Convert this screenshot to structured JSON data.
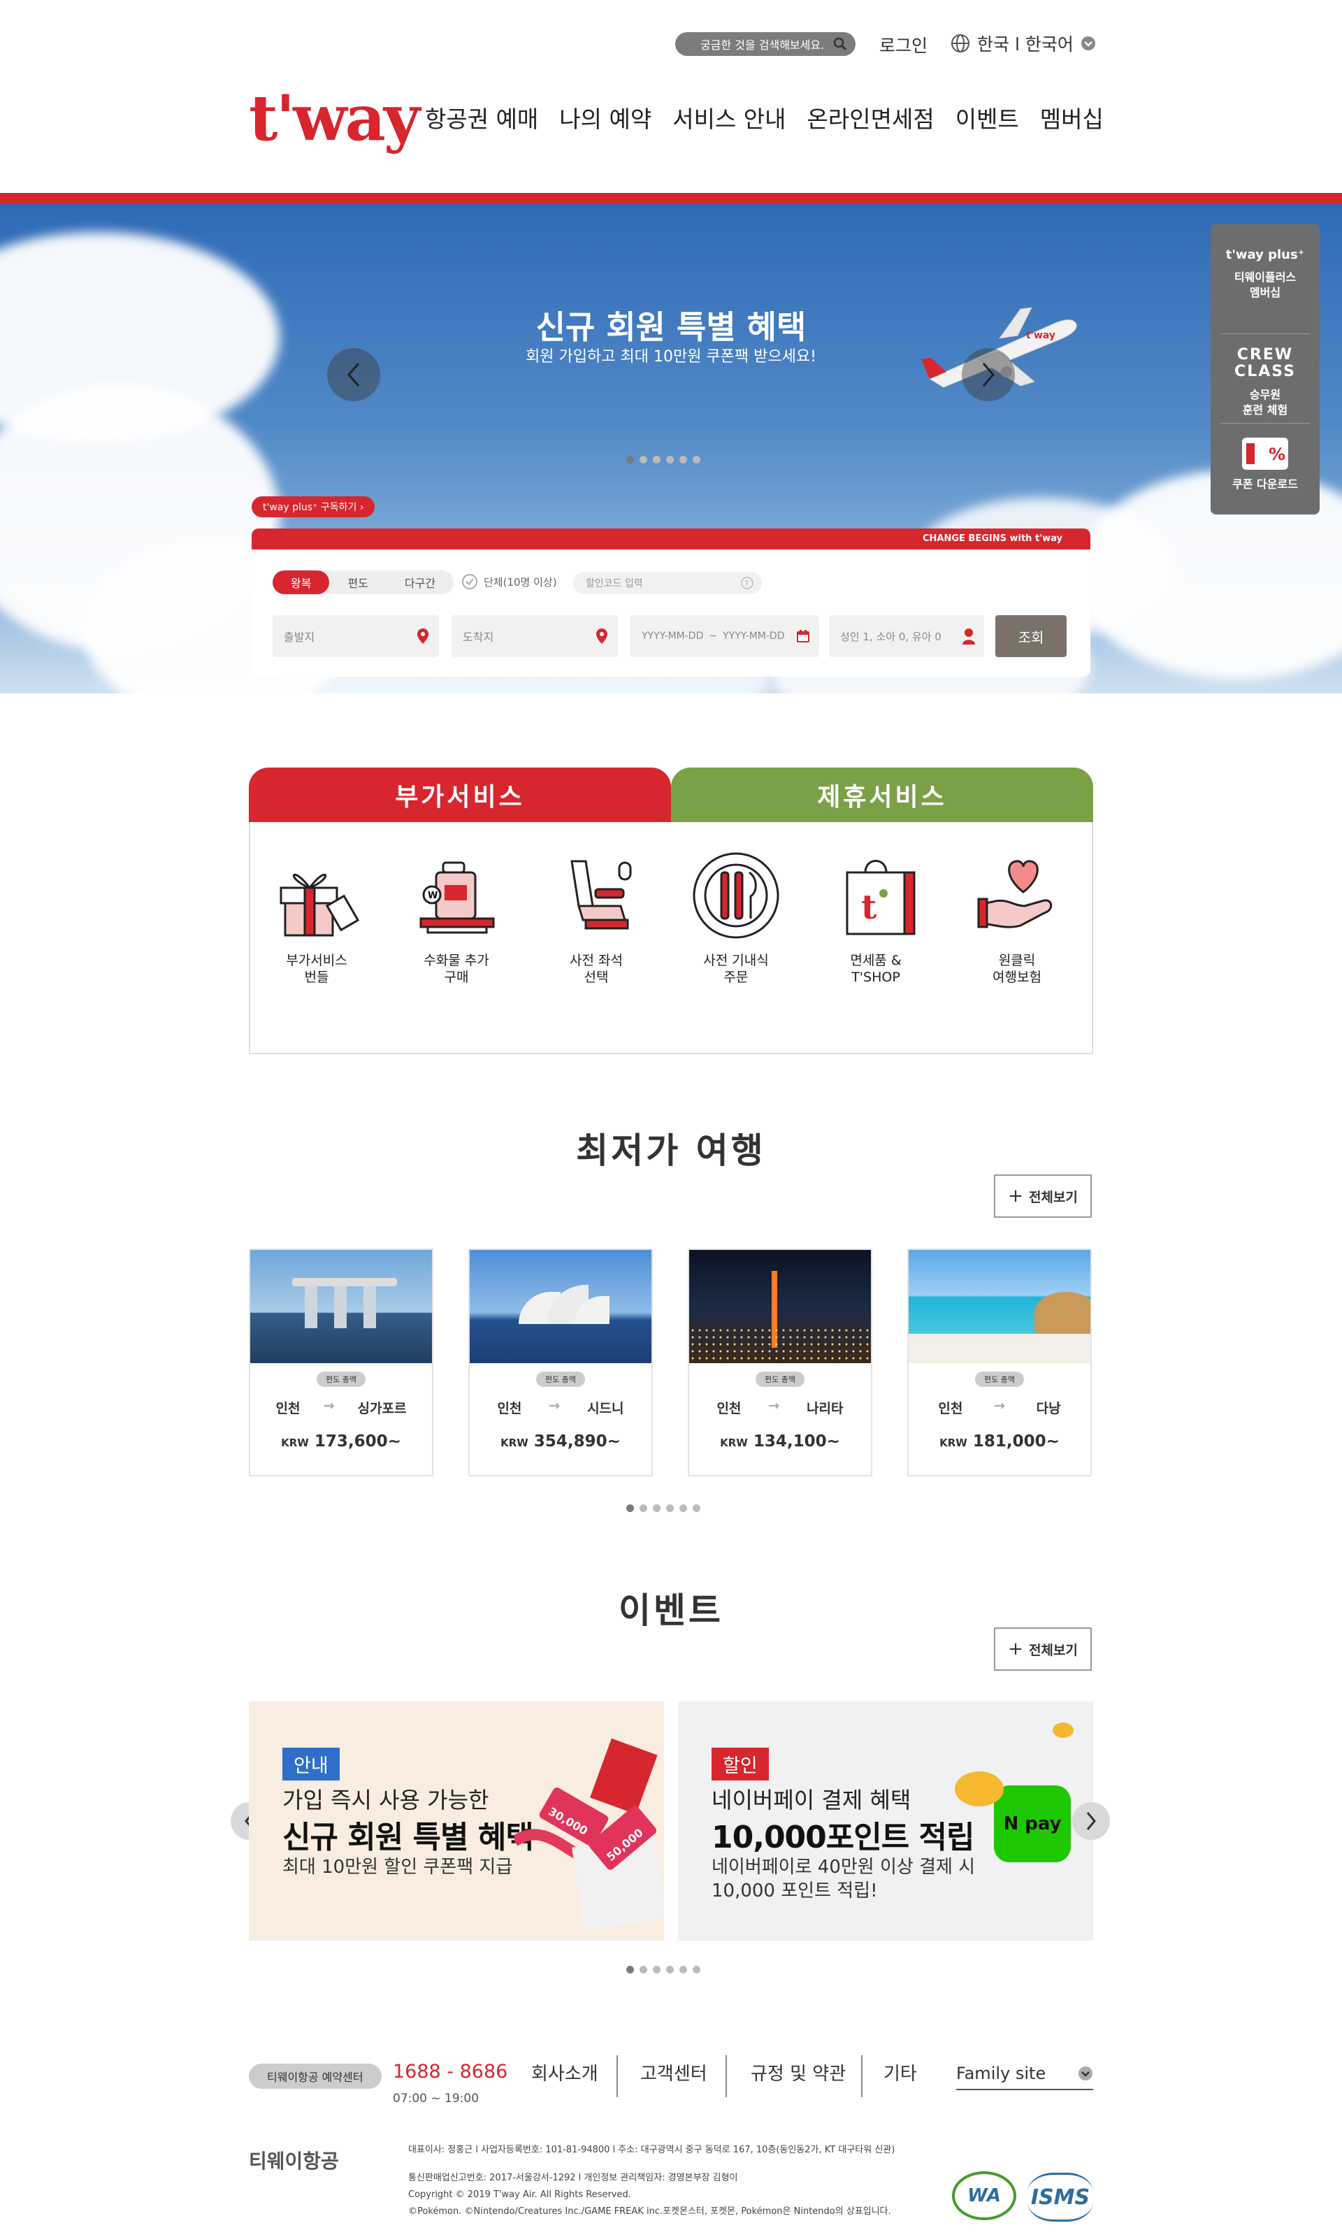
{
  "header": {
    "search_placeholder": "궁금한 것을 검색해보세요.",
    "login": "로그인",
    "language": "한국 l 한국어",
    "logo": "t'way",
    "nav": [
      "항공권 예매",
      "나의 예약",
      "서비스 안내",
      "온라인면세점",
      "이벤트",
      "멤버십"
    ]
  },
  "hero": {
    "title": "신규 회원 특별 혜택",
    "subtitle": "회원 가입하고 최대 10만원 쿠폰팩 받으세요!",
    "plane_livery": "t'way",
    "slide_count": 6,
    "active_slide": 0
  },
  "quick_menu": {
    "plus_logo": "t'way plus⁺",
    "plus_label": "티웨이플러스\n멤버십",
    "crew_logo": "CREW\nCLASS",
    "crew_label": "승무원\n훈련 체험",
    "coupon_label": "쿠폰 다운로드"
  },
  "booking": {
    "plus_badge": "t'way plus⁺ 구독하기 ›",
    "banner": "CHANGE BEGINS with t'way",
    "trip_types": [
      "왕복",
      "편도",
      "다구간"
    ],
    "active_trip": "왕복",
    "group_label": "단체(10명 이상)",
    "promo_placeholder": "할인코드 입력",
    "departure": "출발지",
    "arrival": "도착지",
    "date_from": "YYYY-MM-DD",
    "date_sep": "~",
    "date_to": "YYYY-MM-DD",
    "passengers": "성인 1, 소아 0, 유아 0",
    "search_button": "조회"
  },
  "services": {
    "tab_extra": "부가서비스",
    "tab_partner": "제휴서비스",
    "items": [
      {
        "label": "부가서비스\n번들",
        "icon": "gift-bundle-icon"
      },
      {
        "label": "수화물 추가\n구매",
        "icon": "baggage-icon"
      },
      {
        "label": "사전 좌석\n선택",
        "icon": "seat-icon"
      },
      {
        "label": "사전 기내식\n주문",
        "icon": "meal-icon"
      },
      {
        "label": "면세품 &\nT'SHOP",
        "icon": "shopping-bag-icon"
      },
      {
        "label": "원클릭\n여행보험",
        "icon": "heart-hand-icon"
      }
    ]
  },
  "deals": {
    "title": "최저가 여행",
    "more": "전체보기",
    "currency": "KRW",
    "items": [
      {
        "tag": "편도 총액",
        "from": "인천",
        "to": "싱가포르",
        "price": "173,600~"
      },
      {
        "tag": "편도 총액",
        "from": "인천",
        "to": "시드니",
        "price": "354,890~"
      },
      {
        "tag": "편도 총액",
        "from": "인천",
        "to": "나리타",
        "price": "134,100~"
      },
      {
        "tag": "편도 총액",
        "from": "인천",
        "to": "다낭",
        "price": "181,000~"
      }
    ],
    "slide_count": 6
  },
  "events": {
    "title": "이벤트",
    "more": "전체보기",
    "items": [
      {
        "badge": "안내",
        "line1": "가입 즉시 사용 가능한",
        "line2": "신규 회원 특별 혜택",
        "line3": "최대 10만원 할인 쿠폰팩 지급",
        "ticket1": "30,000",
        "ticket2": "50,000"
      },
      {
        "badge": "할인",
        "line1": "네이버페이 결제 혜택",
        "line2": "10,000포인트 적립",
        "line3": "네이버페이로 40만원 이상 결제 시\n10,000 포인트 적립!",
        "pay_logo": "N pay"
      }
    ],
    "slide_count": 6
  },
  "footer": {
    "resv_center": "티웨이항공 예약센터",
    "phone": "1688 - 8686",
    "hours": "07:00 ~ 19:00",
    "nav": [
      "회사소개",
      "고객센터",
      "규정 및 약관",
      "기타"
    ],
    "family_site": "Family site",
    "corp_name": "티웨이항공",
    "info1": "대표이사: 정홍근    l    사업자등록번호: 101-81-94800    l    주소: 대구광역시 중구 동덕로 167, 10층(동인동2가, KT 대구타워 신관)",
    "info2": "통신판매업신고번호: 2017-서울강서-1292    l    개인정보 관리책임자: 경영본부장 김형이",
    "info3": "Copyright © 2019 T'way Air. All Rights Reserved.",
    "info4": "©Pokémon. ©Nintendo/Creatures Inc./GAME FREAK inc.포켓몬스터, 포켓몬, Pokémon은 Nintendo의 상표입니다.",
    "cert1": "WA",
    "cert2": "ISMS"
  },
  "colors": {
    "brand_red": "#d7262e",
    "partner_green": "#7ba147",
    "dark_gray": "#6d6d6d"
  }
}
